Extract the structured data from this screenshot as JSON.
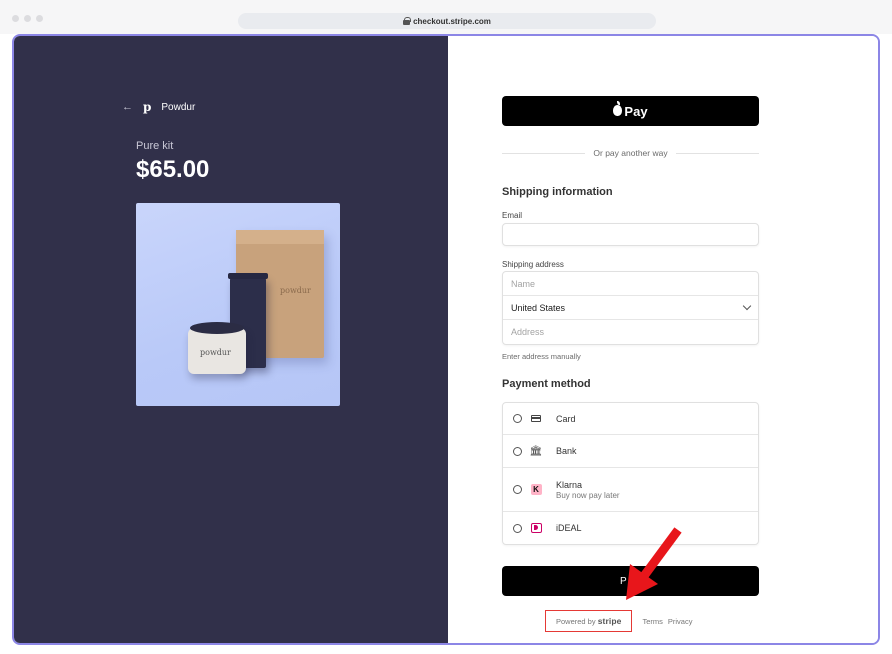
{
  "browser": {
    "url": "checkout.stripe.com"
  },
  "merchant": {
    "back_icon": "arrow-left-icon",
    "logo_letter": "p",
    "name": "Powdur"
  },
  "product": {
    "name": "Pure kit",
    "price": "$65.00",
    "box_label": "powdur",
    "jar_label": "powdur"
  },
  "checkout": {
    "apple_pay_label": "Pay",
    "divider_text": "Or pay another way",
    "shipping_title": "Shipping information",
    "email_label": "Email",
    "email_value": "",
    "address_label": "Shipping address",
    "name_placeholder": "Name",
    "country_value": "United States",
    "address_placeholder": "Address",
    "manual_link": "Enter address manually",
    "payment_title": "Payment method",
    "methods": [
      {
        "label": "Card",
        "sub": "",
        "icon": "card-icon"
      },
      {
        "label": "Bank",
        "sub": "",
        "icon": "bank-icon"
      },
      {
        "label": "Klarna",
        "sub": "Buy now pay later",
        "icon": "klarna-icon"
      },
      {
        "label": "iDEAL",
        "sub": "",
        "icon": "ideal-icon"
      }
    ],
    "pay_button_visible": "P"
  },
  "footer": {
    "powered_prefix": "Powered by",
    "powered_brand": "stripe",
    "terms": "Terms",
    "privacy": "Privacy"
  },
  "colors": {
    "left_panel": "#31304a",
    "frame_border": "#8c86e6",
    "annotation": "#e53935"
  }
}
